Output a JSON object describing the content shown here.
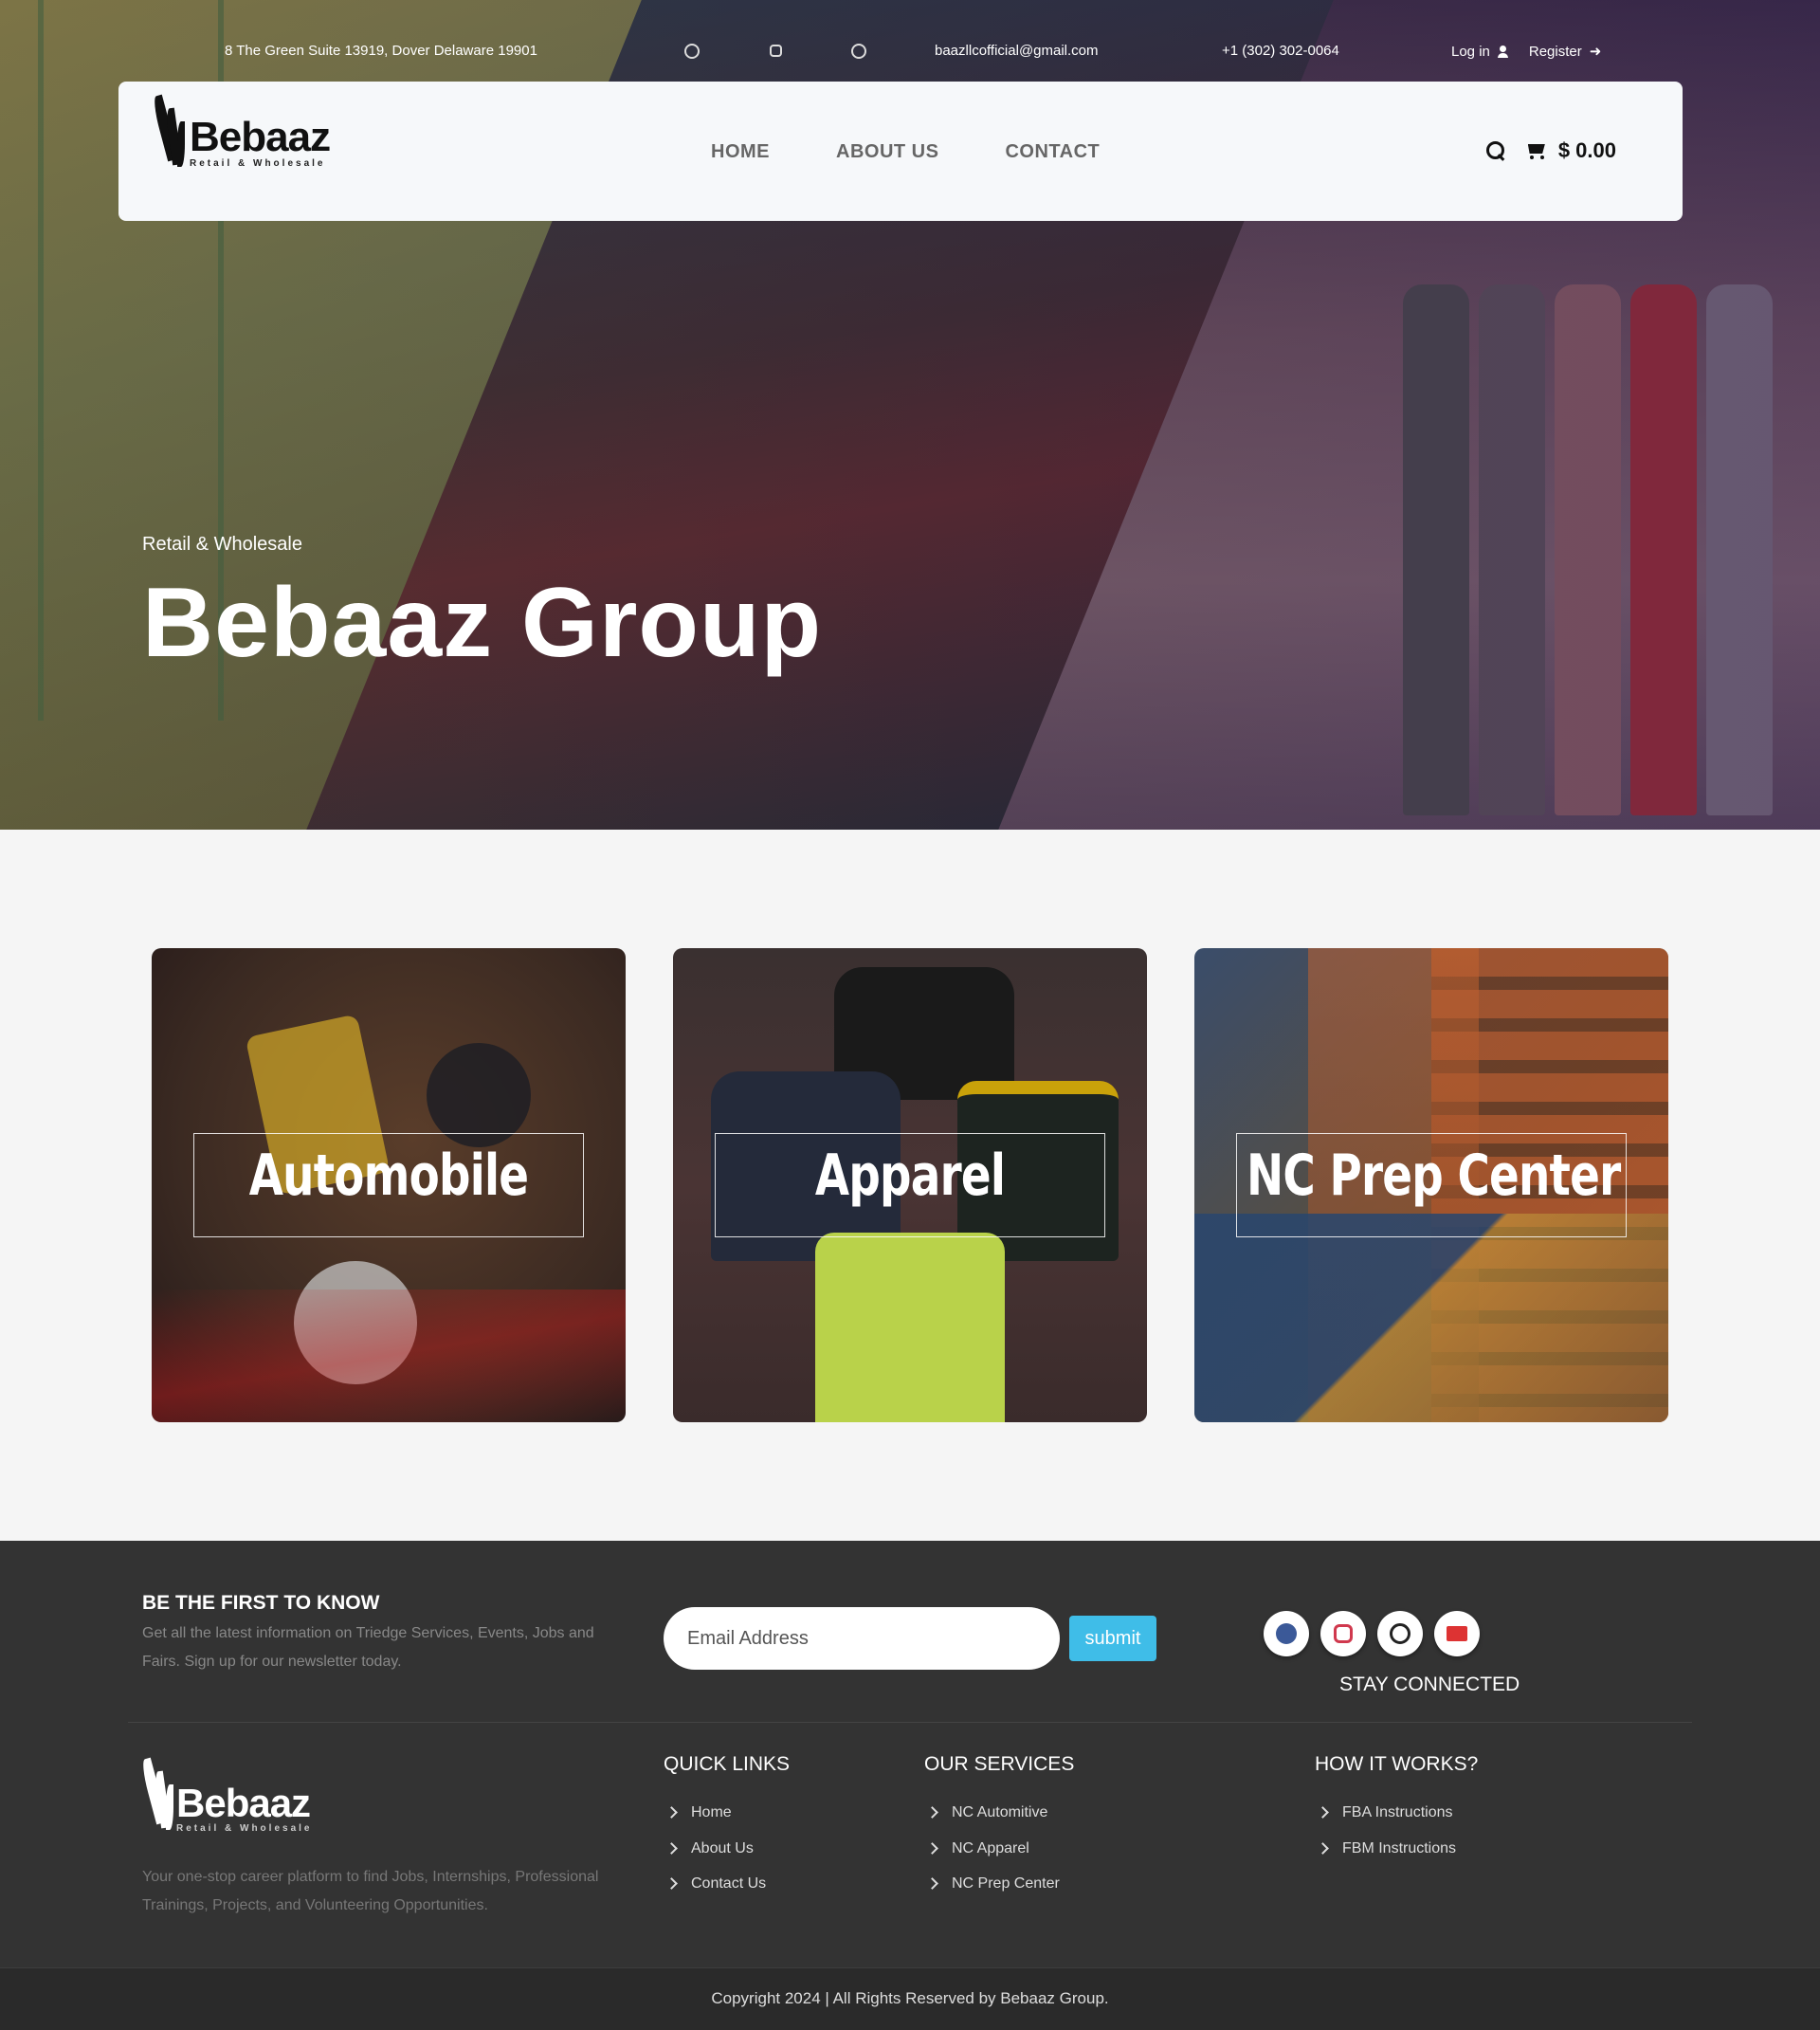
{
  "topbar": {
    "address": "8 The Green Suite 13919, Dover Delaware 19901",
    "email": "baazllcofficial@gmail.com",
    "phone": "+1 (302) 302-0064",
    "login_label": "Log in",
    "register_label": "Register"
  },
  "header": {
    "brand": "Bebaaz",
    "brand_tagline": "Retail & Wholesale",
    "nav": [
      "HOME",
      "ABOUT US",
      "CONTACT"
    ],
    "cart_total": "$ 0.00"
  },
  "hero": {
    "subtitle": "Retail & Wholesale",
    "title": "Bebaaz Group"
  },
  "categories": [
    {
      "label": "Automobile"
    },
    {
      "label": "Apparel"
    },
    {
      "label": "NC Prep Center"
    }
  ],
  "newsletter": {
    "title": "BE THE FIRST TO KNOW",
    "text": "Get all the latest information on Triedge Services, Events, Jobs and Fairs. Sign up for our newsletter today.",
    "email_placeholder": "Email Address",
    "submit_label": "submit",
    "stay_connected": "STAY CONNECTED"
  },
  "footer": {
    "brand": "Bebaaz",
    "brand_tagline": "Retail & Wholesale",
    "about": "Your one-stop career platform to find Jobs, Internships, Professional Trainings, Projects, and Volunteering Opportunities.",
    "quick_links": {
      "title": "QUICK LINKS",
      "items": [
        "Home",
        "About Us",
        "Contact Us"
      ]
    },
    "services": {
      "title": "OUR SERVICES",
      "items": [
        "NC Automitive",
        "NC Apparel",
        "NC Prep Center"
      ]
    },
    "how": {
      "title": "HOW IT WORKS?",
      "items": [
        "FBA Instructions",
        "FBM Instructions"
      ]
    },
    "copyright": "Copyright 2024 | All Rights Reserved by Bebaaz Group."
  },
  "colors": {
    "accent_button": "#3fbde8",
    "footer_bg": "#333333",
    "header_card_bg": "#f6f8fa"
  },
  "icons": [
    "facebook-icon",
    "instagram-icon",
    "whatsapp-icon",
    "user-icon",
    "login-arrow-icon",
    "search-icon",
    "cart-icon",
    "mail-icon",
    "chevron-right-icon"
  ]
}
